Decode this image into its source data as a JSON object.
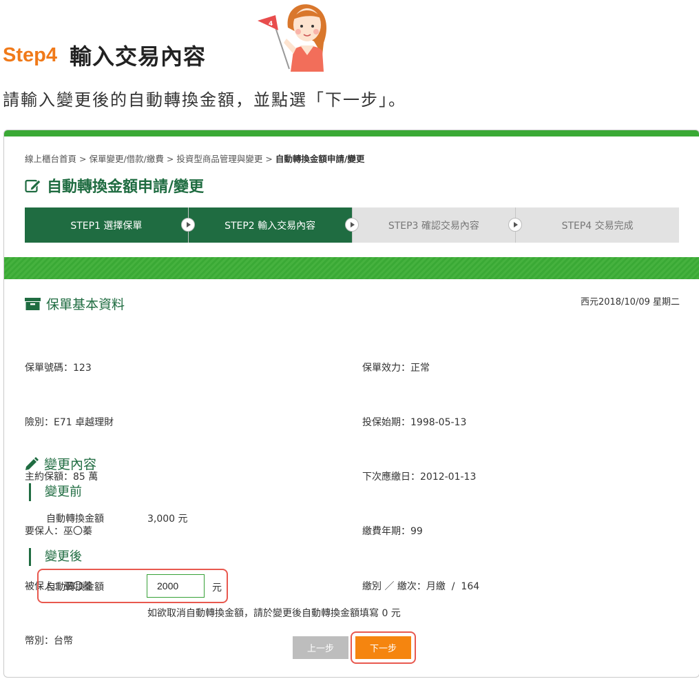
{
  "header": {
    "step_label": "Step4",
    "title": "輸入交易內容",
    "flag_number": "4",
    "intro": "請輸入變更後的自動轉換金額，並點選「下一步」。"
  },
  "breadcrumb": {
    "items": [
      "線上櫃台首頁",
      "保單變更/借款/繳費",
      "投資型商品管理與變更"
    ],
    "separator": ">",
    "current": "自動轉換金額申請/變更"
  },
  "page_title": "自動轉換金額申請/變更",
  "steps": [
    {
      "label": "STEP1 選擇保單",
      "state": "done"
    },
    {
      "label": "STEP2 輸入交易內容",
      "state": "current"
    },
    {
      "label": "STEP3 確認交易內容",
      "state": "pending"
    },
    {
      "label": "STEP4 交易完成",
      "state": "pending"
    }
  ],
  "policy": {
    "heading": "保單基本資料",
    "date": "西元2018/10/09 星期二",
    "left": [
      "保單號碼：123",
      "險別：E71 卓越理財",
      "主約保額：85 萬",
      "要保人：巫〇蓁",
      "被保人：巫〇蓁",
      "幣別：台幣"
    ],
    "right": [
      "保單效力：正常",
      "投保始期：1998-05-13",
      "下次應繳日：2012-01-13",
      "繳費年期：99",
      "繳別 ／ 繳次：月繳  /  164"
    ]
  },
  "change": {
    "heading": "變更內容",
    "before": {
      "heading": "變更前",
      "label": "自動轉換金額",
      "value": "3,000 元"
    },
    "after": {
      "heading": "變更後",
      "label": "自動轉換金額",
      "input_value": "2000",
      "unit": "元",
      "note": "如欲取消自動轉換金額，請於變更後自動轉換金額填寫 0 元"
    }
  },
  "buttons": {
    "prev": "上一步",
    "next": "下一步"
  },
  "colors": {
    "brand_green": "#1f6c41",
    "bright_green": "#3aa935",
    "orange": "#f5850f",
    "highlight_red": "#e8584e",
    "step_orange": "#f07a1a"
  }
}
